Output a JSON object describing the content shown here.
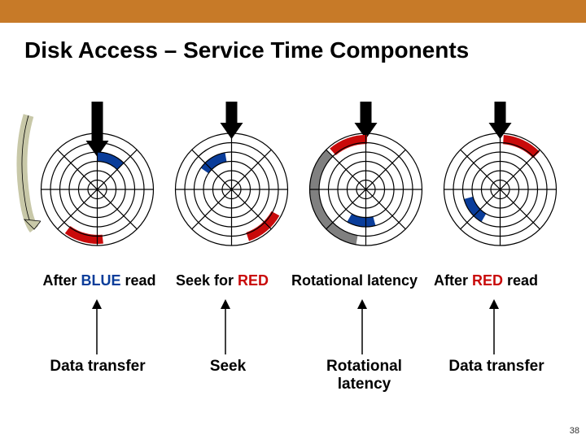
{
  "colors": {
    "topbar": "#c77a28",
    "blue": "#0a3d9a",
    "red": "#c90a0a",
    "gray": "#808080"
  },
  "title": "Disk Access – Service Time Components",
  "captions": {
    "c1_pre": "After ",
    "c1_blue": "BLUE",
    "c1_post": " read",
    "c2_pre": "Seek for ",
    "c2_red": "RED",
    "c3": "Rotational latency",
    "c4_pre": "After ",
    "c4_red": "RED",
    "c4_post": " read"
  },
  "labels": {
    "l1": "Data transfer",
    "l2": "Seek",
    "l3": "Rotational\nlatency",
    "l4": "Data transfer"
  },
  "page": "38"
}
